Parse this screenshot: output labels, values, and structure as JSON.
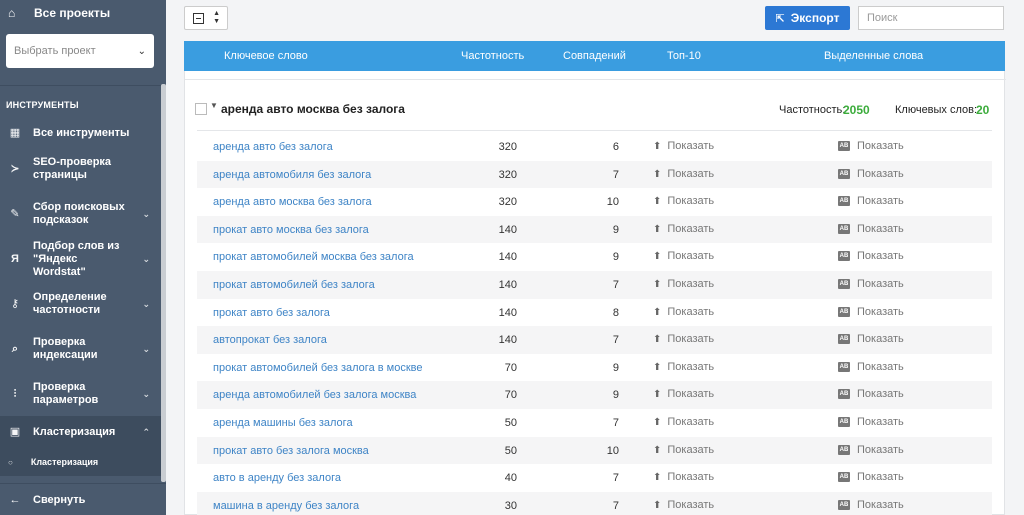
{
  "sidebar": {
    "all_projects": "Все проекты",
    "project_select_placeholder": "Выбрать проект",
    "section_title": "ИНСТРУМЕНТЫ",
    "items": [
      {
        "label": "Все инструменты",
        "icon": "grid-icon"
      },
      {
        "label": "SEO-проверка страницы",
        "icon": "terminal-icon"
      },
      {
        "label": "Сбор поисковых подсказок",
        "icon": "pencil-icon"
      },
      {
        "label": "Подбор слов из \"Яндекс Wordstat\"",
        "icon": "ya-icon"
      },
      {
        "label": "Определение частотности",
        "icon": "key-icon"
      },
      {
        "label": "Проверка индексации",
        "icon": "search-icon"
      },
      {
        "label": "Проверка параметров",
        "icon": "sliders-icon"
      },
      {
        "label": "Кластеризация",
        "icon": "folder-icon"
      }
    ],
    "sub_item": "Кластеризация",
    "collapse": "Свернуть"
  },
  "toolbar": {
    "export_label": "Экспорт",
    "search_placeholder": "Поиск"
  },
  "table": {
    "headers": [
      "Ключевое слово",
      "Частотность",
      "Совпадений",
      "Топ-10",
      "Выделенные слова"
    ]
  },
  "group": {
    "title": "аренда авто москва без залога",
    "freq_label": "Частотность:",
    "freq_value": "2050",
    "kw_label": "Ключевых слов:",
    "kw_value": "20"
  },
  "show_label": "Показать",
  "rows": [
    {
      "kw": "аренда авто без залога",
      "freq": "320",
      "match": "6"
    },
    {
      "kw": "аренда автомобиля без залога",
      "freq": "320",
      "match": "7"
    },
    {
      "kw": "аренда авто москва без залога",
      "freq": "320",
      "match": "10"
    },
    {
      "kw": "прокат авто москва без залога",
      "freq": "140",
      "match": "9"
    },
    {
      "kw": "прокат автомобилей москва без залога",
      "freq": "140",
      "match": "9"
    },
    {
      "kw": "прокат автомобилей без залога",
      "freq": "140",
      "match": "7"
    },
    {
      "kw": "прокат авто без залога",
      "freq": "140",
      "match": "8"
    },
    {
      "kw": "автопрокат без залога",
      "freq": "140",
      "match": "7"
    },
    {
      "kw": "прокат автомобилей без залога в москве",
      "freq": "70",
      "match": "9"
    },
    {
      "kw": "аренда автомобилей без залога москва",
      "freq": "70",
      "match": "9"
    },
    {
      "kw": "аренда машины без залога",
      "freq": "50",
      "match": "7"
    },
    {
      "kw": "прокат авто без залога москва",
      "freq": "50",
      "match": "10"
    },
    {
      "kw": "авто в аренду без залога",
      "freq": "40",
      "match": "7"
    },
    {
      "kw": "машина в аренду без залога",
      "freq": "30",
      "match": "7"
    }
  ]
}
